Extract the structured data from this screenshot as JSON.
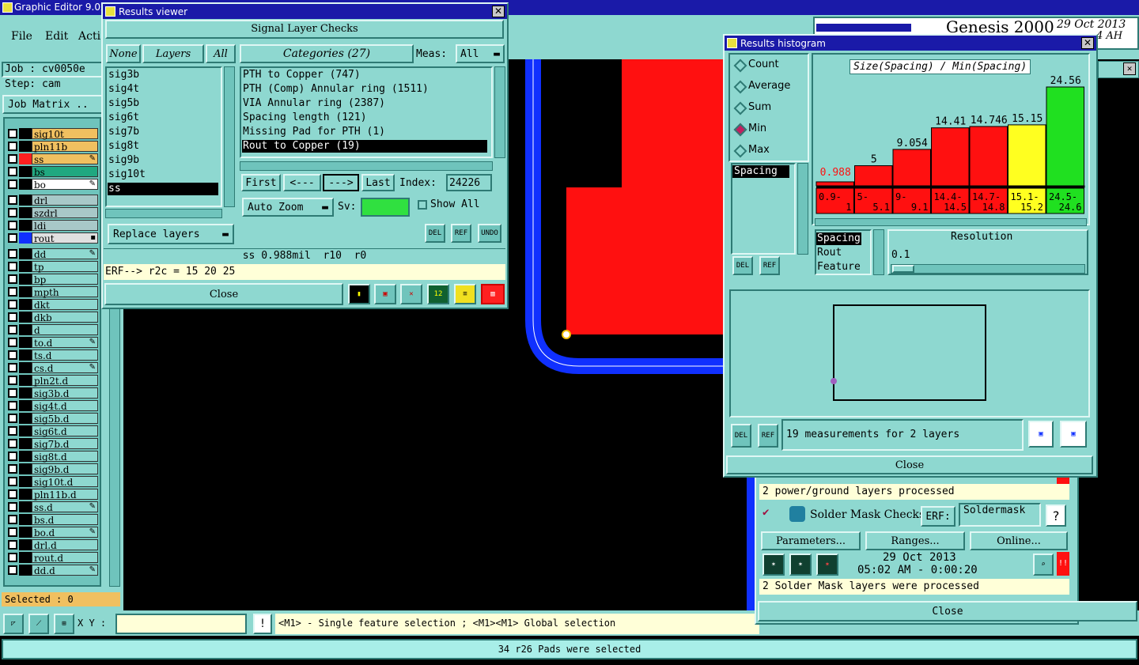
{
  "app": {
    "title": "Graphic Editor 9.02",
    "menu": [
      "File",
      "Edit",
      "Acti"
    ]
  },
  "job": {
    "job_label": "Job : cv0050e",
    "step_label": "Step: cam",
    "matrix_btn": "Job Matrix .."
  },
  "genesis": {
    "brand": "Genesis 2000",
    "date": "29 Oct 2013",
    "time": "4 AH"
  },
  "layers": [
    {
      "name": "sig10t",
      "color": "#f0c060",
      "mark": ""
    },
    {
      "name": "pln11b",
      "color": "#f0c060",
      "mark": ""
    },
    {
      "name": "ss",
      "color": "#f0c060",
      "mark": "✎",
      "swatch": "#ff2020"
    },
    {
      "name": "bs",
      "color": "#20a880",
      "mark": ""
    },
    {
      "name": "bo",
      "color": "#ffffff",
      "mark": "✎"
    },
    {
      "name": "drl",
      "color": "#a8c8c8",
      "mark": ""
    },
    {
      "name": "szdrl",
      "color": "#a8c8c8",
      "mark": ""
    },
    {
      "name": "ldi",
      "color": "#a8c8c8",
      "mark": ""
    },
    {
      "name": "rout",
      "color": "#e0e0e0",
      "mark": "▪",
      "swatch": "#1030ff"
    },
    {
      "name": "dd",
      "color": "#8ed8d0",
      "mark": "✎"
    },
    {
      "name": "tp",
      "color": "#8ed8d0",
      "mark": ""
    },
    {
      "name": "bp",
      "color": "#8ed8d0",
      "mark": ""
    },
    {
      "name": "mpth",
      "color": "#8ed8d0",
      "mark": ""
    },
    {
      "name": "dkt",
      "color": "#8ed8d0",
      "mark": ""
    },
    {
      "name": "dkb",
      "color": "#8ed8d0",
      "mark": ""
    },
    {
      "name": "d",
      "color": "#8ed8d0",
      "mark": ""
    },
    {
      "name": "to.d",
      "color": "#8ed8d0",
      "mark": "✎"
    },
    {
      "name": "ts.d",
      "color": "#8ed8d0",
      "mark": ""
    },
    {
      "name": "cs.d",
      "color": "#8ed8d0",
      "mark": "✎"
    },
    {
      "name": "pln2t.d",
      "color": "#8ed8d0",
      "mark": ""
    },
    {
      "name": "sig3b.d",
      "color": "#8ed8d0",
      "mark": ""
    },
    {
      "name": "sig4t.d",
      "color": "#8ed8d0",
      "mark": ""
    },
    {
      "name": "sig5b.d",
      "color": "#8ed8d0",
      "mark": ""
    },
    {
      "name": "sig6t.d",
      "color": "#8ed8d0",
      "mark": ""
    },
    {
      "name": "sig7b.d",
      "color": "#8ed8d0",
      "mark": ""
    },
    {
      "name": "sig8t.d",
      "color": "#8ed8d0",
      "mark": ""
    },
    {
      "name": "sig9b.d",
      "color": "#8ed8d0",
      "mark": ""
    },
    {
      "name": "sig10t.d",
      "color": "#8ed8d0",
      "mark": ""
    },
    {
      "name": "pln11b.d",
      "color": "#8ed8d0",
      "mark": ""
    },
    {
      "name": "ss.d",
      "color": "#8ed8d0",
      "mark": "✎"
    },
    {
      "name": "bs.d",
      "color": "#8ed8d0",
      "mark": ""
    },
    {
      "name": "bo.d",
      "color": "#8ed8d0",
      "mark": "✎"
    },
    {
      "name": "drl.d",
      "color": "#8ed8d0",
      "mark": ""
    },
    {
      "name": "rout.d",
      "color": "#8ed8d0",
      "mark": ""
    },
    {
      "name": "dd.d",
      "color": "#8ed8d0",
      "mark": "✎"
    }
  ],
  "selected_label": "Selected : 0",
  "bottom": {
    "xy_label": "X Y :",
    "hint": "<M1> - Single feature selection ; <M1><M1> Global selection",
    "status": "34 r26 Pads were selected"
  },
  "results_viewer": {
    "title": "Results viewer",
    "header": "Signal Layer Checks",
    "none_btn": "None",
    "layers_label": "Layers",
    "all_btn": "All",
    "categories_label": "Categories (27)",
    "meas_label": "Meas:",
    "meas_value": "All",
    "layer_list": [
      "sig3b",
      "sig4t",
      "sig5b",
      "sig6t",
      "sig7b",
      "sig8t",
      "sig9b",
      "sig10t",
      "ss"
    ],
    "selected_layer": "ss",
    "categories": [
      "PTH to Copper (747)",
      "PTH (Comp) Annular ring (1511)",
      "VIA Annular ring (2387)",
      "Spacing length (121)",
      "Missing Pad for PTH (1)",
      "Rout to Copper (19)"
    ],
    "selected_category": "Rout to Copper (19)",
    "first_btn": "First",
    "prev_btn": "<---",
    "next_btn": "--->",
    "last_btn": "Last",
    "index_label": "Index:",
    "index_value": "24226",
    "auto_zoom": "Auto Zoom",
    "sv_label": "Sv:",
    "show_all": "Show All",
    "replace_layers": "Replace layers",
    "del": "DEL",
    "ref": "REF",
    "undo": "UNDO",
    "info_line": "ss 0.988mil  r10  r0",
    "erf_line": "ERF--> r2c = 15 20 25",
    "close": "Close"
  },
  "histogram": {
    "title": "Results histogram",
    "modes": [
      "Count",
      "Average",
      "Sum",
      "Min",
      "Max"
    ],
    "selected_mode": "Min",
    "list_item": "Spacing",
    "chart_title": "Size(Spacing) / Min(Spacing)",
    "resolution_label": "Resolution",
    "resolution_value": "0.1",
    "type_list": [
      "Spacing",
      "Rout",
      "Feature"
    ],
    "summary": "19 measurements for 2 layers",
    "close": "Close",
    "del": "DEL",
    "ref": "REF"
  },
  "chart_data": {
    "type": "bar",
    "title": "Size(Spacing) / Min(Spacing)",
    "categories": [
      "0.9-1",
      "5-5.1",
      "9-9.1",
      "14.4-14.5",
      "14.7-14.8",
      "15.1-15.2",
      "24.5-24.6"
    ],
    "values": [
      0.988,
      5,
      9.054,
      14.41,
      14.746,
      15.15,
      24.56
    ],
    "value_labels": [
      "0.988",
      "5",
      "9.054",
      "14.41",
      "14.746",
      "15.15",
      "24.56"
    ],
    "colors": [
      "#ff1010",
      "#ff1010",
      "#ff1010",
      "#ff1010",
      "#ff1010",
      "#ffff20",
      "#20e020"
    ],
    "cat_lines": [
      [
        "0.9-",
        "1"
      ],
      [
        "5-",
        "5.1"
      ],
      [
        "9-",
        "9.1"
      ],
      [
        "14.4-",
        "14.5"
      ],
      [
        "14.7-",
        "14.8"
      ],
      [
        "15.1-",
        "15.2"
      ],
      [
        "24.5-",
        "24.6"
      ]
    ],
    "ylim": [
      0,
      24.56
    ],
    "xlabel": "",
    "ylabel": ""
  },
  "checklist": {
    "pg_processed": "2 power/ground layers processed",
    "solder_title": "Solder Mask Checks",
    "erf_label": "ERF:",
    "erf_value": "Soldermask",
    "help": "?",
    "params": "Parameters...",
    "ranges": "Ranges...",
    "online": "Online...",
    "date": "29 Oct 2013",
    "time": "05:02 AM - 0:00:20",
    "sm_processed": "2 Solder Mask layers were processed",
    "close": "Close"
  }
}
